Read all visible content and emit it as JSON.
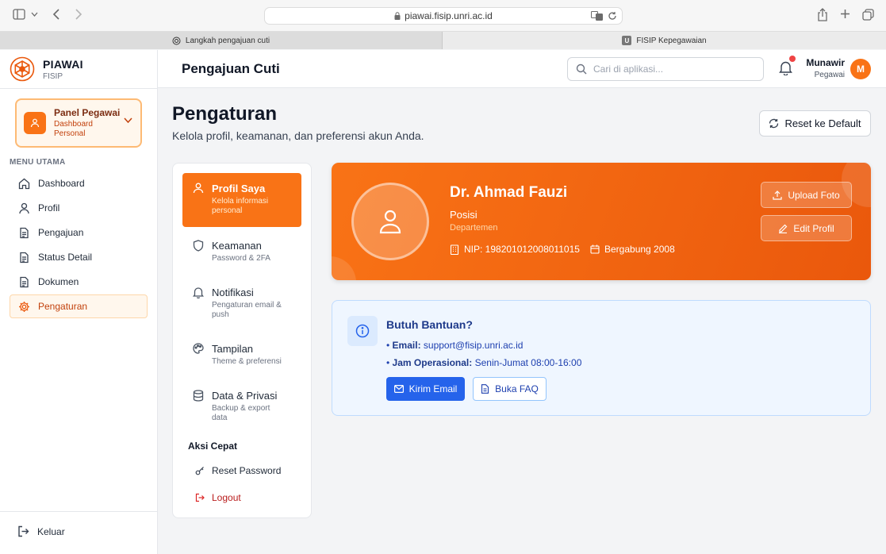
{
  "browser": {
    "url": "piawai.fisip.unri.ac.id",
    "tabs": [
      {
        "label": "Langkah pengajuan cuti"
      },
      {
        "label": "FISIP Kepegawaian",
        "favicon": "U"
      }
    ]
  },
  "brand": {
    "name": "PIAWAI",
    "sub": "FISIP"
  },
  "panel": {
    "title": "Panel Pegawai",
    "sub": "Dashboard Personal"
  },
  "sidebar": {
    "menu_label": "MENU UTAMA",
    "items": [
      {
        "label": "Dashboard",
        "icon": "home-icon"
      },
      {
        "label": "Profil",
        "icon": "user-icon"
      },
      {
        "label": "Pengajuan",
        "icon": "document-icon"
      },
      {
        "label": "Status Detail",
        "icon": "document-icon"
      },
      {
        "label": "Dokumen",
        "icon": "document-icon"
      },
      {
        "label": "Pengaturan",
        "icon": "gear-icon",
        "active": true
      }
    ],
    "logout": "Keluar"
  },
  "header": {
    "title": "Pengajuan Cuti",
    "search_placeholder": "Cari di aplikasi...",
    "user_name": "Munawir",
    "user_role": "Pegawai",
    "avatar_initial": "M"
  },
  "main": {
    "title": "Pengaturan",
    "subtitle": "Kelola profil, keamanan, dan preferensi akun Anda.",
    "reset_label": "Reset ke Default"
  },
  "settings_nav": {
    "items": [
      {
        "title": "Profil Saya",
        "sub": "Kelola informasi personal",
        "icon": "user-icon",
        "active": true
      },
      {
        "title": "Keamanan",
        "sub": "Password & 2FA",
        "icon": "shield-icon"
      },
      {
        "title": "Notifikasi",
        "sub": "Pengaturan email & push",
        "icon": "bell-icon"
      },
      {
        "title": "Tampilan",
        "sub": "Theme & preferensi",
        "icon": "palette-icon"
      },
      {
        "title": "Data & Privasi",
        "sub": "Backup & export data",
        "icon": "database-icon"
      }
    ],
    "quick_label": "Aksi Cepat",
    "quick": [
      {
        "label": "Reset Password",
        "icon": "key-icon"
      },
      {
        "label": "Logout",
        "icon": "logout-icon"
      }
    ]
  },
  "profile": {
    "name": "Dr. Ahmad Fauzi",
    "position": "Posisi",
    "department": "Departemen",
    "nip": "NIP: 198201012008011015",
    "joined": "Bergabung 2008",
    "upload_label": "Upload Foto",
    "edit_label": "Edit Profil"
  },
  "help": {
    "title": "Butuh Bantuan?",
    "email_label": "Email:",
    "email_value": "support@fisip.unri.ac.id",
    "hours_label": "Jam Operasional:",
    "hours_value": "Senin-Jumat 08:00-16:00",
    "email_button": "Kirim Email",
    "faq_button": "Buka FAQ"
  },
  "colors": {
    "accent": "#f97316",
    "accent_dark": "#ea580c",
    "info": "#2563eb"
  }
}
